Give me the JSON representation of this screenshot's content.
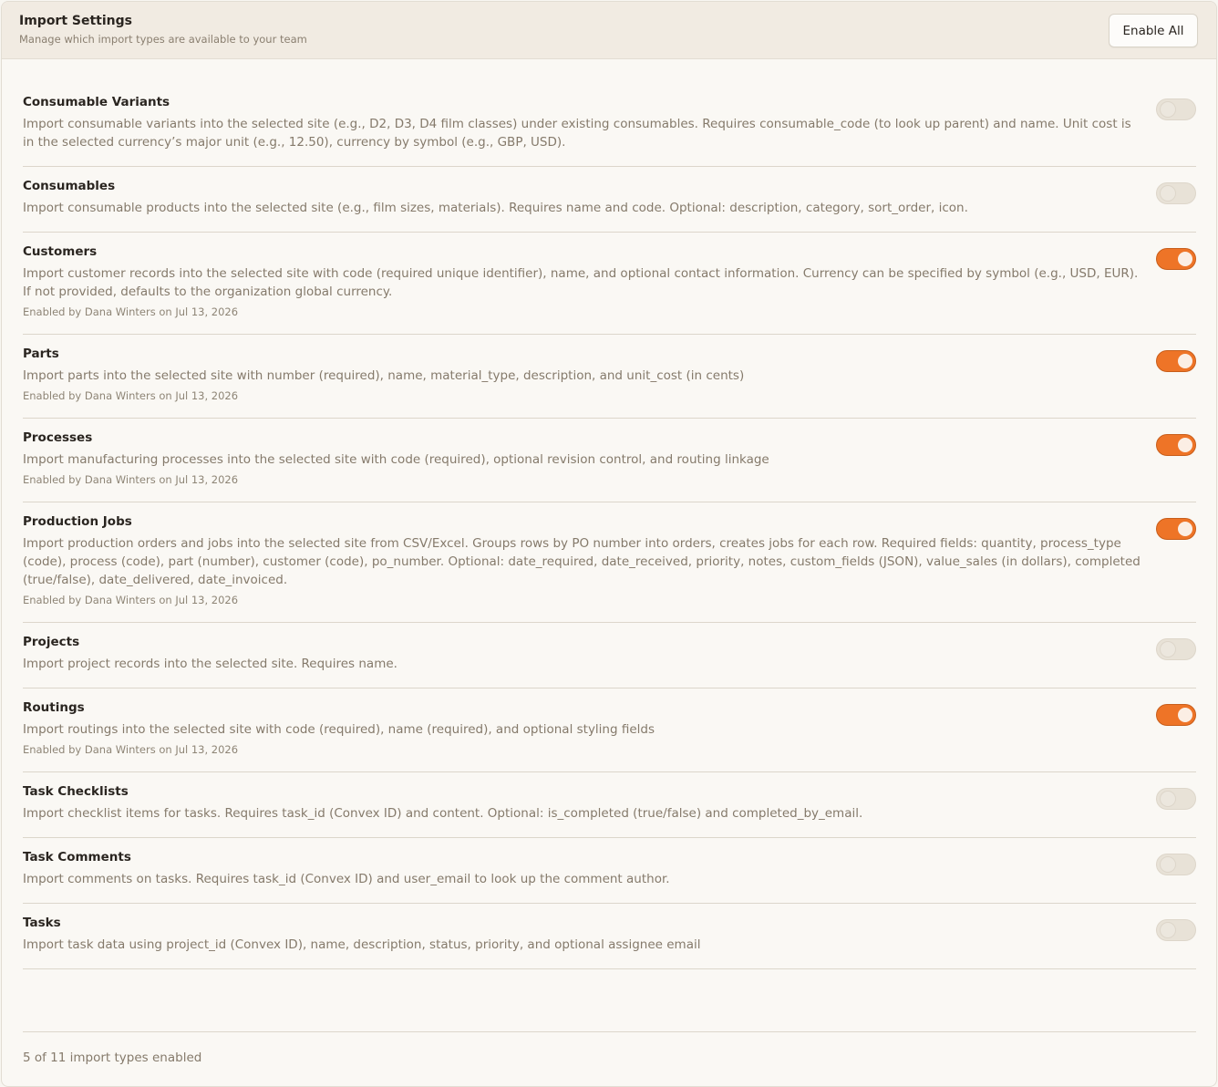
{
  "header": {
    "title": "Import Settings",
    "subtitle": "Manage which import types are available to your team",
    "enable_all_label": "Enable All"
  },
  "colors": {
    "accent": "#ee7427",
    "toggle_off": "#e8e2d7"
  },
  "items": [
    {
      "name": "Consumable Variants",
      "description": "Import consumable variants into the selected site (e.g., D2, D3, D4 film classes) under existing consumables. Requires consumable_code (to look up parent) and name. Unit cost is in the selected currency’s major unit (e.g., 12.50), currency by symbol (e.g., GBP, USD).",
      "enabled": false,
      "meta": ""
    },
    {
      "name": "Consumables",
      "description": "Import consumable products into the selected site (e.g., film sizes, materials). Requires name and code. Optional: description, category, sort_order, icon.",
      "enabled": false,
      "meta": ""
    },
    {
      "name": "Customers",
      "description": "Import customer records into the selected site with code (required unique identifier), name, and optional contact information. Currency can be specified by symbol (e.g., USD, EUR). If not provided, defaults to the organization global currency.",
      "enabled": true,
      "meta": "Enabled by Dana Winters on Jul 13, 2026"
    },
    {
      "name": "Parts",
      "description": "Import parts into the selected site with number (required), name, material_type, description, and unit_cost (in cents)",
      "enabled": true,
      "meta": "Enabled by Dana Winters on Jul 13, 2026"
    },
    {
      "name": "Processes",
      "description": "Import manufacturing processes into the selected site with code (required), optional revision control, and routing linkage",
      "enabled": true,
      "meta": "Enabled by Dana Winters on Jul 13, 2026"
    },
    {
      "name": "Production Jobs",
      "description": "Import production orders and jobs into the selected site from CSV/Excel. Groups rows by PO number into orders, creates jobs for each row. Required fields: quantity, process_type (code), process (code), part (number), customer (code), po_number. Optional: date_required, date_received, priority, notes, custom_fields (JSON), value_sales (in dollars), completed (true/false), date_delivered, date_invoiced.",
      "enabled": true,
      "meta": "Enabled by Dana Winters on Jul 13, 2026"
    },
    {
      "name": "Projects",
      "description": "Import project records into the selected site. Requires name.",
      "enabled": false,
      "meta": ""
    },
    {
      "name": "Routings",
      "description": "Import routings into the selected site with code (required), name (required), and optional styling fields",
      "enabled": true,
      "meta": "Enabled by Dana Winters on Jul 13, 2026"
    },
    {
      "name": "Task Checklists",
      "description": "Import checklist items for tasks. Requires task_id (Convex ID) and content. Optional: is_completed (true/false) and completed_by_email.",
      "enabled": false,
      "meta": ""
    },
    {
      "name": "Task Comments",
      "description": "Import comments on tasks. Requires task_id (Convex ID) and user_email to look up the comment author.",
      "enabled": false,
      "meta": ""
    },
    {
      "name": "Tasks",
      "description": "Import task data using project_id (Convex ID), name, description, status, priority, and optional assignee email",
      "enabled": false,
      "meta": ""
    }
  ],
  "footer": {
    "summary": "5 of 11 import types enabled"
  }
}
